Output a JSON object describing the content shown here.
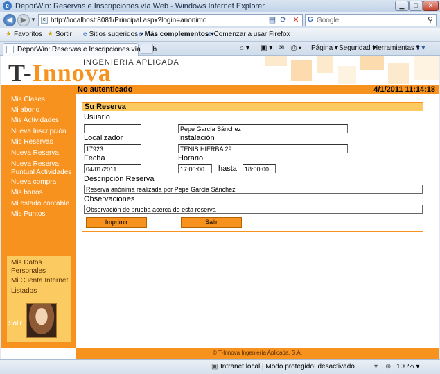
{
  "window": {
    "title": "DeporWin: Reservas e Inscripciones vía Web - Windows Internet Explorer"
  },
  "address_bar": {
    "url": "http://localhost:8081/Principal.aspx?login=anonimo",
    "search_placeholder": "Google"
  },
  "favorites_bar": {
    "favorites": "Favoritos",
    "sort": "Sortir",
    "suggested_sites": "Sitios sugeridos",
    "more_addons": "Más complementos",
    "firefox": "Comenzar a usar Firefox"
  },
  "tab": {
    "label": "DeporWin: Reservas e Inscripciones vía Web"
  },
  "command_bar": {
    "page": "Página",
    "security": "Seguridad",
    "tools": "Herramientas"
  },
  "header": {
    "logo_sub": "INGENIERIA APLICADA",
    "logo_t": "T-",
    "logo_rest": "Innova",
    "auth_status": "No autenticado",
    "datetime": "4/1/2011 11:14:18"
  },
  "sidebar": {
    "items": [
      "Mis Clases",
      "Mi abono",
      "Mis Actividades",
      "Nueva Inscripción",
      "Mis Reservas",
      "Nueva Reserva",
      "Nueva Reserva",
      "Puntual Actividades",
      "Nueva compra",
      "Mis bonos",
      "Mi estado contable",
      "Mis Puntos"
    ],
    "personal": [
      "Mis Datos",
      "Personales",
      "Mi Cuenta Internet",
      "Listados"
    ],
    "logout": "Salir"
  },
  "form": {
    "title": "Su Reserva",
    "usuario_label": "Usuario",
    "usuario_value": "",
    "usuario_name": "Pepe García Sánchez",
    "localizador_label": "Localizador",
    "localizador_value": "17923",
    "instalacion_label": "Instalación",
    "instalacion_value": "TENIS HIERBA 29",
    "fecha_label": "Fecha",
    "fecha_value": "04/01/2011",
    "horario_label": "Horario",
    "hora_desde": "17:00:00",
    "hasta_label": "hasta",
    "hora_hasta": "18:00:00",
    "descripcion_label": "Descripción Reserva",
    "descripcion_value": "Reserva anónima realizada por Pepe García Sánchez",
    "observaciones_label": "Observaciones",
    "observaciones_value": "Observación de prueba acerca de esta reserva",
    "print_button": "Imprimir",
    "exit_button": "Salir"
  },
  "footer": {
    "copyright": "© T-Innova Ingeniería Aplicada, S.A."
  },
  "status_bar": {
    "zone": "Intranet local | Modo protegido: desactivado",
    "zoom": "100%"
  },
  "colors": {
    "accent_orange": "#f7921e",
    "panel_yellow": "#fbcb62",
    "menu_text": "#ffffff"
  }
}
